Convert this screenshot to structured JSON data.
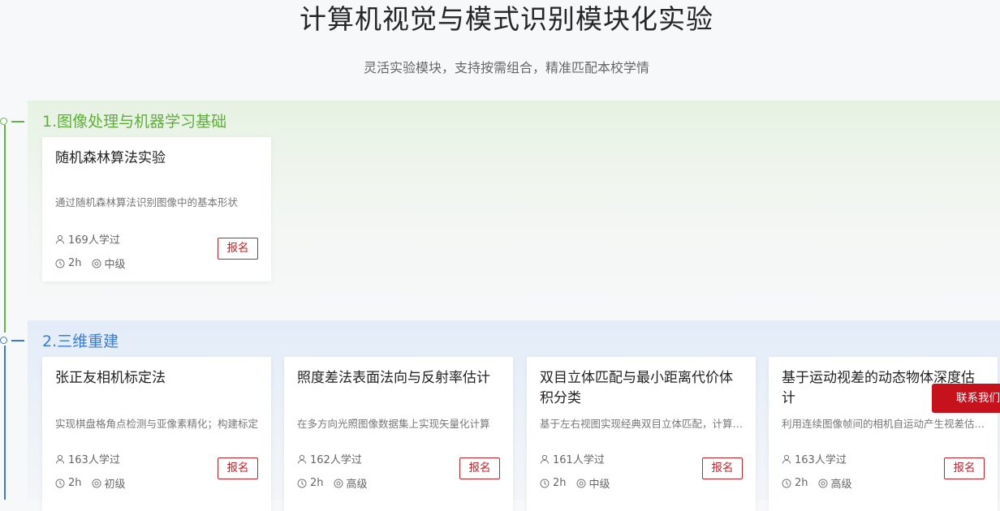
{
  "header": {
    "title": "计算机视觉与模式识别模块化实验",
    "subtitle": "灵活实验模块，支持按需组合，精准匹配本校学情"
  },
  "colors": {
    "green": "#67b246",
    "blue": "#3c78d8",
    "accent_red": "#c9242b"
  },
  "sections": [
    {
      "title": "1.图像处理与机器学习基础",
      "cards": [
        {
          "title": "随机森林算法实验",
          "desc": "通过随机森林算法识别图像中的基本形状",
          "learners": "169人学过",
          "duration": "2h",
          "level": "中级",
          "enroll": "报名"
        }
      ]
    },
    {
      "title": "2.三维重建",
      "cards": [
        {
          "title": "张正友相机标定法",
          "desc": "实现棋盘格角点检测与亚像素精化；构建标定",
          "learners": "163人学过",
          "duration": "2h",
          "level": "初级",
          "enroll": "报名"
        },
        {
          "title": "照度差法表面法向与反射率估计",
          "desc": "在多方向光照图像数据集上实现矢量化计算",
          "learners": "162人学过",
          "duration": "2h",
          "level": "高级",
          "enroll": "报名"
        },
        {
          "title": "双目立体匹配与最小距离代价体积分类",
          "desc": "基于左右视图实现经典双目立体匹配，计算视差",
          "learners": "161人学过",
          "duration": "2h",
          "level": "中级",
          "enroll": "报名"
        },
        {
          "title": "基于运动视差的动态物体深度估计",
          "desc": "利用连续图像帧间的相机自运动产生视差估计深度",
          "learners": "163人学过",
          "duration": "2h",
          "level": "高级",
          "enroll": "报名"
        }
      ]
    }
  ],
  "contact": {
    "label": "联系我们"
  },
  "icons": {
    "learners": "user-icon",
    "duration": "clock-icon",
    "level": "level-icon"
  }
}
